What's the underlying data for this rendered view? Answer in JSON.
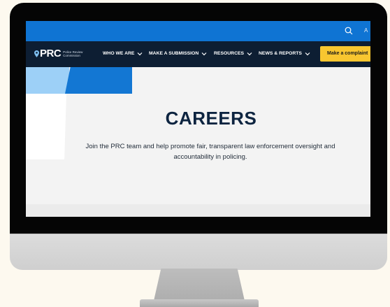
{
  "topbar": {
    "search_icon": "search-icon",
    "truncated_text": "A"
  },
  "logo": {
    "text": "PRC",
    "subtitle": "Police Review Commission",
    "icon": "location-pin-icon"
  },
  "nav": {
    "items": [
      {
        "label": "WHO WE ARE",
        "icon": "chevron-down-icon"
      },
      {
        "label": "MAKE A SUBMISSION",
        "icon": "chevron-down-icon"
      },
      {
        "label": "RESOURCES",
        "icon": "chevron-down-icon"
      },
      {
        "label": "NEWS & REPORTS",
        "icon": "chevron-down-icon"
      }
    ],
    "cta_label": "Make a complaint"
  },
  "hero": {
    "title": "CAREERS",
    "description": "Join the PRC team and help promote fair, transparent law enforcement oversight and accountability in policing."
  },
  "colors": {
    "page_background": "#fdf9ef",
    "topbar": "#0f74d3",
    "nav": "#0d1e33",
    "cta": "#f8c630",
    "title": "#0d2440",
    "accent_light_blue": "#9dd0f7",
    "accent_blue": "#1377d3"
  }
}
